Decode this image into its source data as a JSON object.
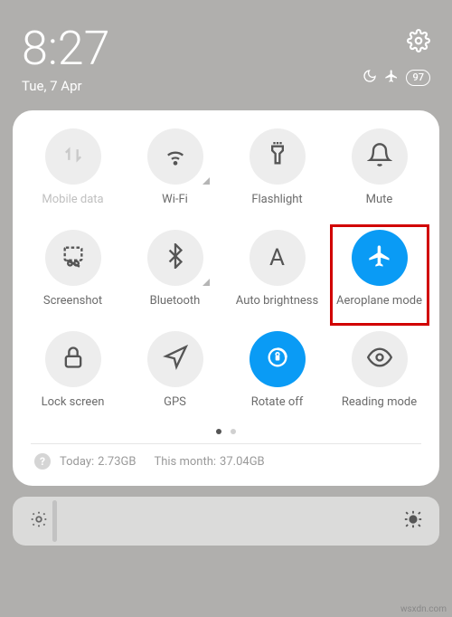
{
  "status": {
    "time": "8:27",
    "date": "Tue, 7 Apr",
    "battery": "97"
  },
  "tiles": [
    {
      "label": "Mobile data"
    },
    {
      "label": "Wi-Fi"
    },
    {
      "label": "Flashlight"
    },
    {
      "label": "Mute"
    },
    {
      "label": "Screenshot"
    },
    {
      "label": "Bluetooth"
    },
    {
      "label": "Auto brightness"
    },
    {
      "label": "Aeroplane mode"
    },
    {
      "label": "Lock screen"
    },
    {
      "label": "GPS"
    },
    {
      "label": "Rotate off"
    },
    {
      "label": "Reading mode"
    }
  ],
  "usage": {
    "today_label": "Today:",
    "today_value": "2.73GB",
    "month_label": "This month:",
    "month_value": "37.04GB"
  },
  "watermark": "wsxdn.com"
}
